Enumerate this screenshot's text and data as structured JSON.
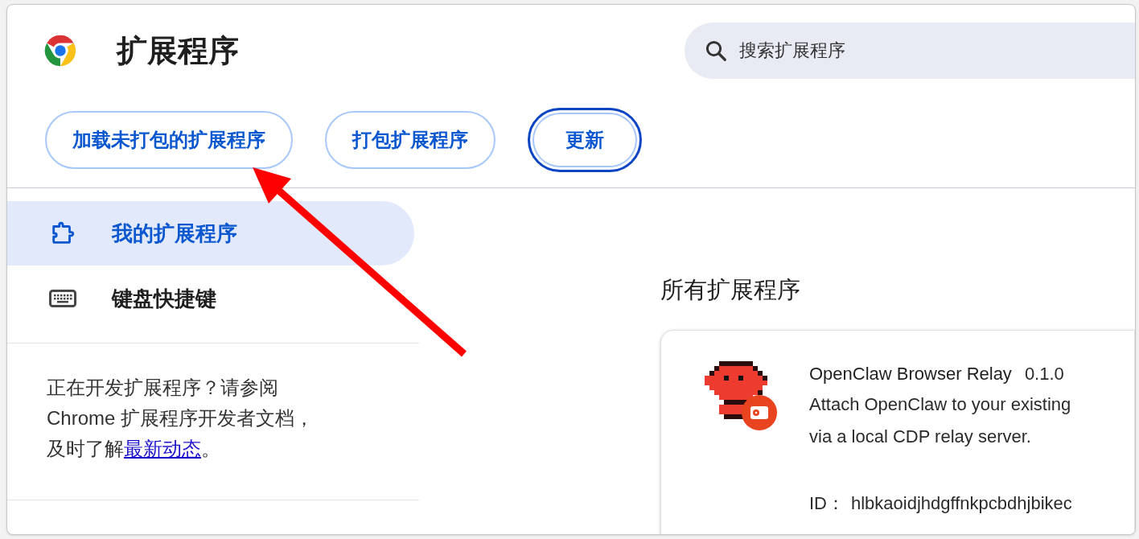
{
  "header": {
    "title": "扩展程序",
    "search": {
      "placeholder": "搜索扩展程序"
    }
  },
  "toolbar_buttons": [
    {
      "label": "加载未打包的扩展程序",
      "focused": false
    },
    {
      "label": "打包扩展程序",
      "focused": false
    },
    {
      "label": "更新",
      "focused": true
    }
  ],
  "sidebar": {
    "items": [
      {
        "label": "我的扩展程序",
        "kind": "puzzle",
        "selected": true
      },
      {
        "label": "键盘快捷键",
        "kind": "keyboard",
        "selected": false
      }
    ],
    "note": {
      "lines": [
        "正在开发扩展程序？请参阅",
        "Chrome 扩展程序开发者文档，"
      ],
      "last_line": "及时了解",
      "link": "最新动态",
      "end": "。"
    }
  },
  "main": {
    "heading": "所有扩展程序",
    "extensions": [
      {
        "name": "OpenClaw Browser Relay",
        "version": "0.1.0",
        "description_lines": [
          "Attach OpenClaw to your existing",
          "via a local CDP relay server."
        ],
        "id_label": "ID：",
        "id": "hlbkaoidjhdgffnkpcbdhjbikec"
      }
    ]
  }
}
